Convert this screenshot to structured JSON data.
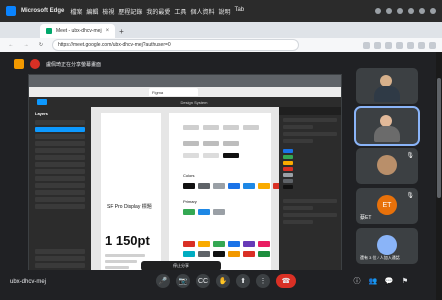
{
  "os": {
    "app_name": "Microsoft Edge",
    "menu": [
      "檔案",
      "編輯",
      "檢視",
      "歷程記錄",
      "我的最愛",
      "工具",
      "個人資料",
      "說明",
      "Tab"
    ]
  },
  "browser": {
    "tab_title": "Meet - ubx-dhcv-mej",
    "tab_close": "×",
    "new_tab": "+",
    "url": "https://meet.google.com/ubx-dhcv-mej?authuser=0",
    "nav": {
      "back": "←",
      "forward": "→",
      "refresh": "↻"
    }
  },
  "meet": {
    "presenter_label": "盧佩琦正在分享螢幕畫面",
    "shared_screen": {
      "inner_tab_label": "Figma",
      "figma_title": "Design System",
      "left_panel_header": "Layers",
      "sf_label": "SF Pro Display 標題",
      "big_text": "1 150pt",
      "colors_label": "Colors",
      "primary_label": "Primary",
      "stop_share": "停止分享"
    },
    "participants": [
      {
        "name": "",
        "type": "video",
        "active": false
      },
      {
        "name": "",
        "type": "video",
        "active": true
      },
      {
        "name": "",
        "type": "avatar",
        "avatar_text": "",
        "avatar_color": "#b98f6a"
      },
      {
        "name": "ET",
        "type": "avatar",
        "avatar_text": "ET",
        "avatar_color": "#e8710a",
        "label": "蔡ET"
      },
      {
        "name": "",
        "type": "group",
        "label": "還有 3 位 / 人加入通話"
      }
    ],
    "meeting_code": "ubx-dhcv-mej",
    "controls": {
      "mic": "🎤",
      "cam": "📷",
      "cc": "CC",
      "hand": "✋",
      "present": "⬆",
      "more": "⋮",
      "end": "☎"
    },
    "right_controls": [
      "ⓘ",
      "👥",
      "💬",
      "⚑"
    ]
  },
  "colors": {
    "swatches_row1": [
      "#111111",
      "#5f6368",
      "#9aa0a6",
      "#1a73e8",
      "#1e88e5",
      "#f9ab00",
      "#d93025"
    ],
    "swatches_row2": [
      "#d93025",
      "#f9ab00",
      "#34a853",
      "#1a73e8",
      "#673ab7",
      "#e91e63",
      "#00acc1"
    ],
    "swatches_row3": [
      "#34a853",
      "#1e88e5",
      "#9aa0a6"
    ]
  }
}
